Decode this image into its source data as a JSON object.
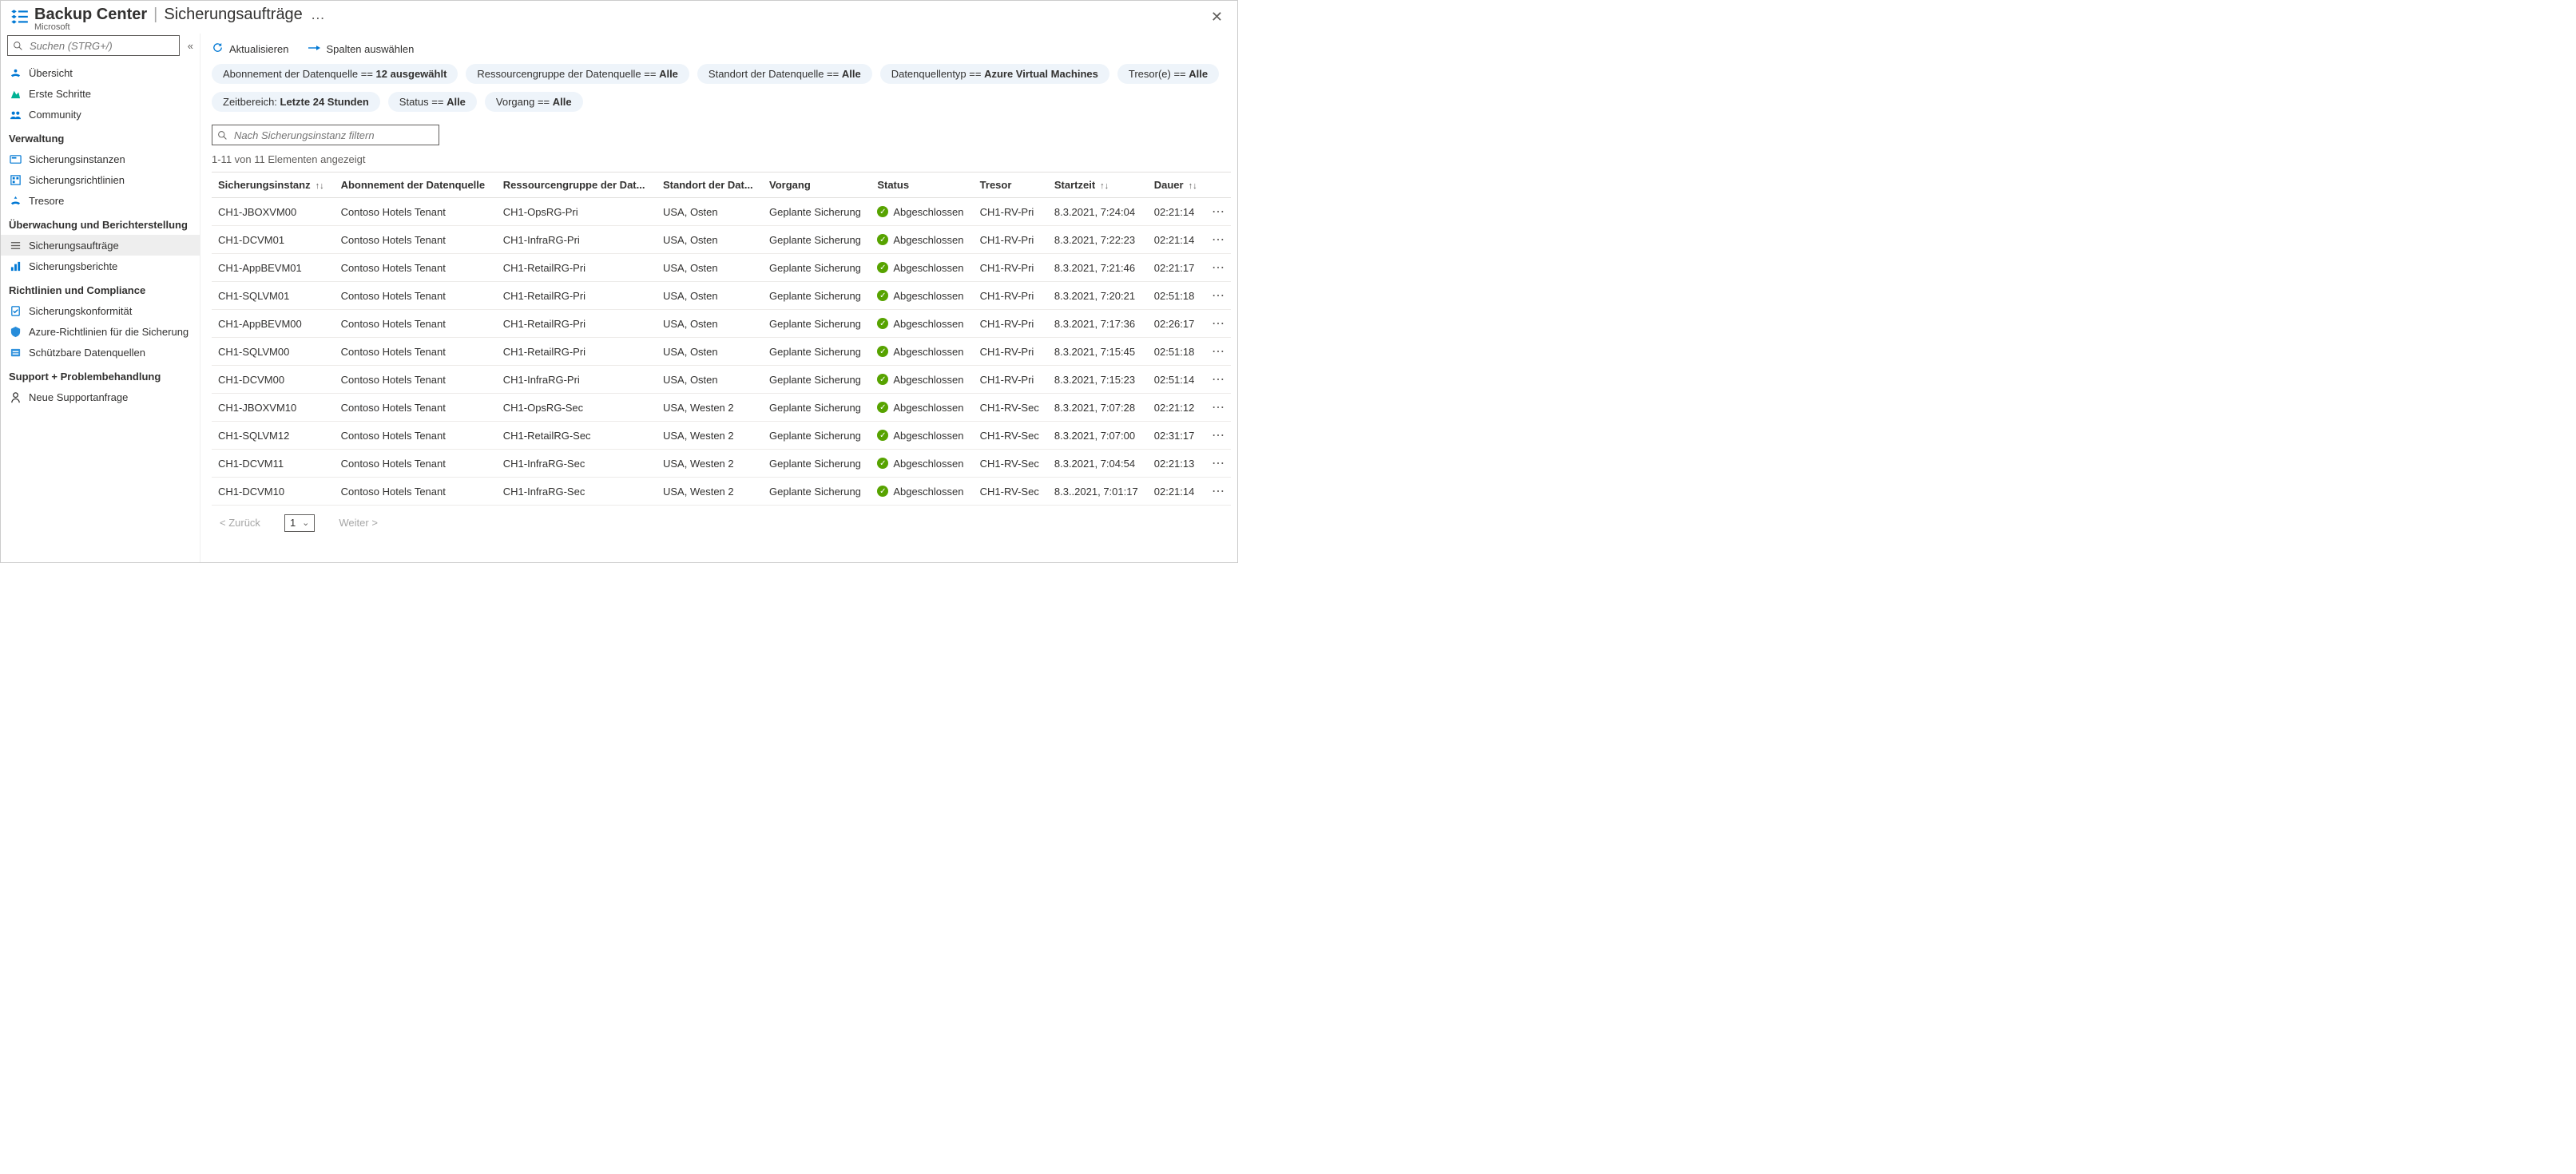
{
  "header": {
    "brand": "Backup Center",
    "separator": "|",
    "page_title": "Sicherungsaufträge",
    "more": "…",
    "vendor": "Microsoft",
    "close": "✕"
  },
  "sidebar": {
    "search_placeholder": "Suchen (STRG+/)",
    "collapse": "«",
    "top_items": [
      {
        "icon": "overview-icon",
        "label": "Übersicht"
      },
      {
        "icon": "getstarted-icon",
        "label": "Erste Schritte"
      },
      {
        "icon": "community-icon",
        "label": "Community"
      }
    ],
    "sections": [
      {
        "title": "Verwaltung",
        "items": [
          {
            "icon": "instances-icon",
            "label": "Sicherungsinstanzen"
          },
          {
            "icon": "policies-icon",
            "label": "Sicherungsrichtlinien"
          },
          {
            "icon": "vaults-icon",
            "label": "Tresore"
          }
        ]
      },
      {
        "title": "Überwachung und Berichterstellung",
        "items": [
          {
            "icon": "jobs-icon",
            "label": "Sicherungsaufträge",
            "active": true
          },
          {
            "icon": "reports-icon",
            "label": "Sicherungsberichte"
          }
        ]
      },
      {
        "title": "Richtlinien und Compliance",
        "items": [
          {
            "icon": "compliance-icon",
            "label": "Sicherungskonformität"
          },
          {
            "icon": "azurepolicy-icon",
            "label": "Azure-Richtlinien für die Sicherung"
          },
          {
            "icon": "protectable-icon",
            "label": "Schützbare Datenquellen"
          }
        ]
      },
      {
        "title": "Support + Problembehandlung",
        "items": [
          {
            "icon": "support-icon",
            "label": "Neue Supportanfrage"
          }
        ]
      }
    ]
  },
  "toolbar": {
    "refresh_label": "Aktualisieren",
    "columns_label": "Spalten auswählen"
  },
  "filters": [
    {
      "prefix": "Abonnement der Datenquelle == ",
      "value": "12 ausgewählt"
    },
    {
      "prefix": "Ressourcengruppe der Datenquelle == ",
      "value": "Alle"
    },
    {
      "prefix": "Standort der Datenquelle == ",
      "value": "Alle"
    },
    {
      "prefix": "Datenquellentyp == ",
      "value": "Azure Virtual Machines"
    },
    {
      "prefix": "Tresor(e) == ",
      "value": "Alle"
    },
    {
      "prefix": "Zeitbereich: ",
      "value": "Letzte 24 Stunden"
    },
    {
      "prefix": "Status == ",
      "value": "Alle"
    },
    {
      "prefix": "Vorgang == ",
      "value": "Alle"
    }
  ],
  "instance_filter_placeholder": "Nach Sicherungsinstanz filtern",
  "result_count": "1-11 von 11 Elementen angezeigt",
  "columns": [
    {
      "label": "Sicherungsinstanz",
      "sort": true
    },
    {
      "label": "Abonnement der Datenquelle"
    },
    {
      "label": "Ressourcengruppe der Dat..."
    },
    {
      "label": "Standort der Dat..."
    },
    {
      "label": "Vorgang"
    },
    {
      "label": "Status"
    },
    {
      "label": "Tresor"
    },
    {
      "label": "Startzeit",
      "sort": true
    },
    {
      "label": "Dauer",
      "sort": true
    }
  ],
  "status_label": "Abgeschlossen",
  "rows": [
    {
      "instance": "CH1-JBOXVM00",
      "sub": "Contoso Hotels Tenant",
      "rg": "CH1-OpsRG-Pri",
      "loc": "USA, Osten",
      "op": "Geplante Sicherung",
      "vault": "CH1-RV-Pri",
      "start": "8.3.2021, 7:24:04",
      "dur": "02:21:14"
    },
    {
      "instance": "CH1-DCVM01",
      "sub": "Contoso Hotels Tenant",
      "rg": "CH1-InfraRG-Pri",
      "loc": "USA, Osten",
      "op": "Geplante Sicherung",
      "vault": "CH1-RV-Pri",
      "start": "8.3.2021, 7:22:23",
      "dur": "02:21:14"
    },
    {
      "instance": "CH1-AppBEVM01",
      "sub": "Contoso Hotels Tenant",
      "rg": "CH1-RetailRG-Pri",
      "loc": "USA, Osten",
      "op": "Geplante Sicherung",
      "vault": "CH1-RV-Pri",
      "start": "8.3.2021, 7:21:46",
      "dur": "02:21:17"
    },
    {
      "instance": "CH1-SQLVM01",
      "sub": "Contoso Hotels Tenant",
      "rg": "CH1-RetailRG-Pri",
      "loc": "USA, Osten",
      "op": "Geplante Sicherung",
      "vault": "CH1-RV-Pri",
      "start": "8.3.2021, 7:20:21",
      "dur": "02:51:18"
    },
    {
      "instance": "CH1-AppBEVM00",
      "sub": "Contoso Hotels Tenant",
      "rg": "CH1-RetailRG-Pri",
      "loc": "USA, Osten",
      "op": "Geplante Sicherung",
      "vault": "CH1-RV-Pri",
      "start": "8.3.2021, 7:17:36",
      "dur": "02:26:17"
    },
    {
      "instance": "CH1-SQLVM00",
      "sub": "Contoso Hotels Tenant",
      "rg": "CH1-RetailRG-Pri",
      "loc": "USA, Osten",
      "op": "Geplante Sicherung",
      "vault": "CH1-RV-Pri",
      "start": "8.3.2021, 7:15:45",
      "dur": "02:51:18"
    },
    {
      "instance": "CH1-DCVM00",
      "sub": "Contoso Hotels Tenant",
      "rg": "CH1-InfraRG-Pri",
      "loc": "USA, Osten",
      "op": "Geplante Sicherung",
      "vault": "CH1-RV-Pri",
      "start": "8.3.2021, 7:15:23",
      "dur": "02:51:14"
    },
    {
      "instance": "CH1-JBOXVM10",
      "sub": "Contoso Hotels Tenant",
      "rg": "CH1-OpsRG-Sec",
      "loc": "USA, Westen 2",
      "op": "Geplante Sicherung",
      "vault": "CH1-RV-Sec",
      "start": "8.3.2021, 7:07:28",
      "dur": "02:21:12"
    },
    {
      "instance": "CH1-SQLVM12",
      "sub": "Contoso Hotels Tenant",
      "rg": "CH1-RetailRG-Sec",
      "loc": "USA, Westen 2",
      "op": "Geplante Sicherung",
      "vault": "CH1-RV-Sec",
      "start": "8.3.2021, 7:07:00",
      "dur": "02:31:17"
    },
    {
      "instance": "CH1-DCVM11",
      "sub": "Contoso Hotels Tenant",
      "rg": "CH1-InfraRG-Sec",
      "loc": "USA, Westen 2",
      "op": "Geplante Sicherung",
      "vault": "CH1-RV-Sec",
      "start": "8.3.2021, 7:04:54",
      "dur": "02:21:13"
    },
    {
      "instance": "CH1-DCVM10",
      "sub": "Contoso Hotels Tenant",
      "rg": "CH1-InfraRG-Sec",
      "loc": "USA, Westen 2",
      "op": "Geplante Sicherung",
      "vault": "CH1-RV-Sec",
      "start": "8.3..2021, 7:01:17",
      "dur": "02:21:14"
    }
  ],
  "pager": {
    "back": "< Zurück",
    "page": "1",
    "next": "Weiter >"
  }
}
